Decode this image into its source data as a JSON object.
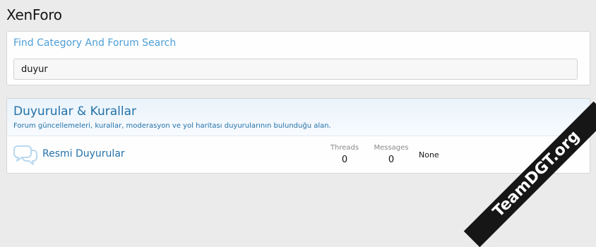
{
  "header": {
    "title": "XenForo"
  },
  "search": {
    "title": "Find Category And Forum Search",
    "value": "duyur"
  },
  "category": {
    "title": "Duyurular & Kurallar",
    "description": "Forum güncellemeleri, kurallar, moderasyon ve yol haritası duyurularının bulunduğu alan.",
    "forums": [
      {
        "icon": "forum-chat-bubbles-icon",
        "title": "Resmi Duyurular",
        "threads_label": "Threads",
        "threads": "0",
        "messages_label": "Messages",
        "messages": "0",
        "last_post": "None"
      }
    ]
  },
  "watermark": "TeamDGT.org",
  "colors": {
    "background": "#ebebeb",
    "link": "#2471a8",
    "search_title": "#4d9ed6",
    "icon": "#b9d8ef"
  }
}
